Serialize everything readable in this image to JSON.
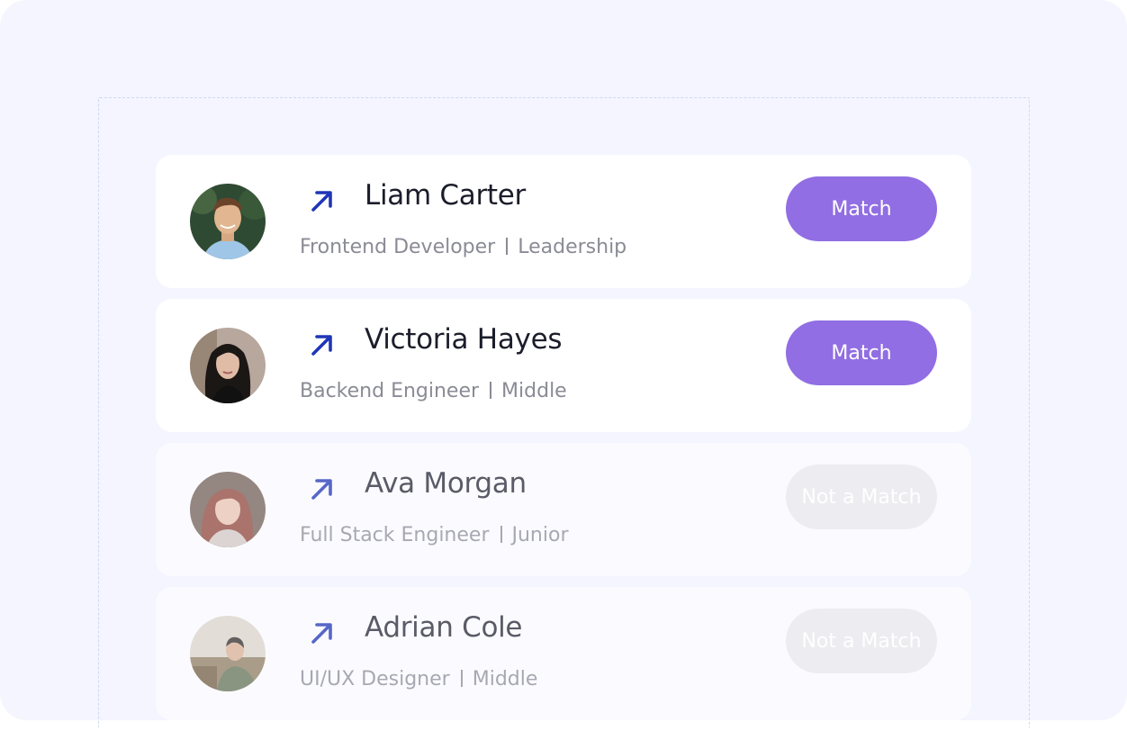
{
  "candidates": [
    {
      "name": "Liam Carter",
      "role": "Frontend Developer",
      "level": "Leadership",
      "status_label": "Match",
      "status": "match",
      "avatar_icon": "person-photo"
    },
    {
      "name": "Victoria Hayes",
      "role": "Backend Engineer",
      "level": "Middle",
      "status_label": "Match",
      "status": "match",
      "avatar_icon": "person-photo"
    },
    {
      "name": "Ava Morgan",
      "role": "Full Stack Engineer",
      "level": "Junior",
      "status_label": "Not a Match",
      "status": "not-match",
      "avatar_icon": "person-photo"
    },
    {
      "name": "Adrian Cole",
      "role": "UI/UX Designer",
      "level": "Middle",
      "status_label": "Not a Match",
      "status": "not-match",
      "avatar_icon": "person-photo"
    }
  ],
  "colors": {
    "accent": "#916ee3",
    "arrow": "#1f36b8",
    "background": "#f4f5fe",
    "disabled_button": "#ececf1"
  },
  "icons": {
    "arrow": "arrow-up-right-icon"
  }
}
